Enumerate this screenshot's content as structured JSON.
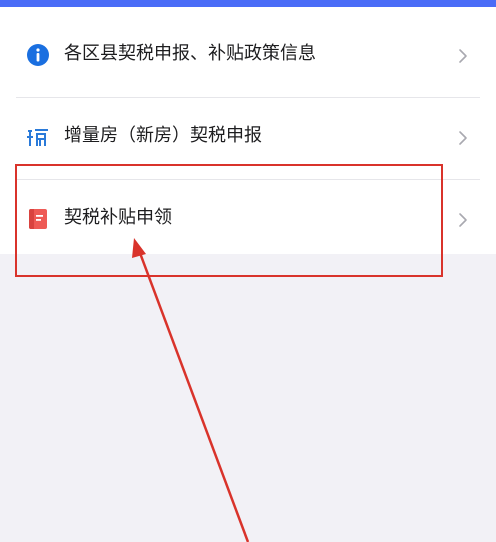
{
  "menu": {
    "items": [
      {
        "label": "各区县契税申报、补贴政策信息",
        "icon": "info-icon"
      },
      {
        "label": "增量房（新房）契税申报",
        "icon": "tax-icon"
      },
      {
        "label": "契税补贴申领",
        "icon": "document-icon"
      }
    ]
  },
  "colors": {
    "accent": "#4a6cf7",
    "info_icon": "#1a6fe0",
    "tax_icon": "#2a7ad9",
    "document_icon": "#ee5a55",
    "annotation": "#d9332b",
    "page_background": "#f2f1f6"
  }
}
